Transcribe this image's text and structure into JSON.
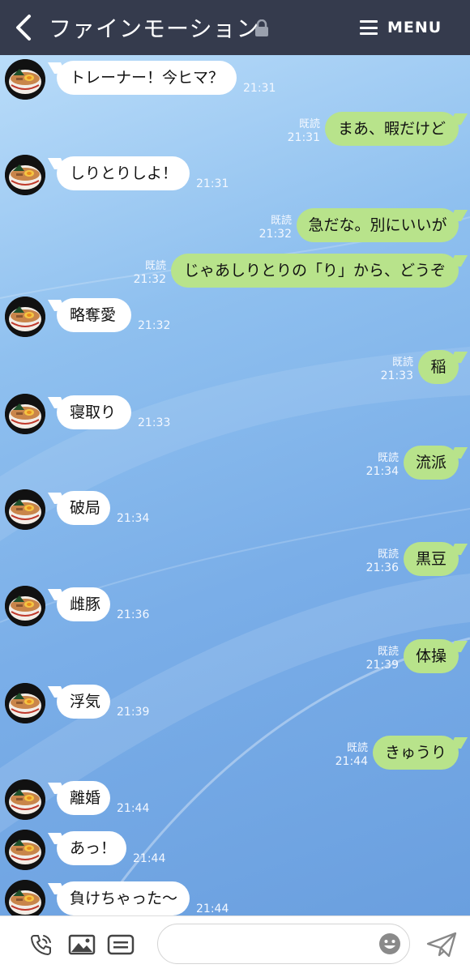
{
  "header": {
    "title": "ファインモーション",
    "menu_label": "MENU"
  },
  "messages": [
    {
      "side": "in",
      "text": "トレーナー！今ヒマ？",
      "time": "21:31"
    },
    {
      "side": "out",
      "text": "まあ、暇だけど",
      "read": "既読",
      "time": "21:31"
    },
    {
      "side": "in",
      "text": "しりとりしよ！",
      "time": "21:31"
    },
    {
      "side": "out",
      "text": "急だな。別にいいが",
      "read": "既読",
      "time": "21:32"
    },
    {
      "side": "out",
      "text": "じゃあしりとりの「り」から、どうぞ",
      "read": "既読",
      "time": "21:32"
    },
    {
      "side": "in",
      "text": "略奪愛",
      "time": "21:32"
    },
    {
      "side": "out",
      "text": "稲",
      "read": "既読",
      "time": "21:33"
    },
    {
      "side": "in",
      "text": "寝取り",
      "time": "21:33"
    },
    {
      "side": "out",
      "text": "流派",
      "read": "既読",
      "time": "21:34"
    },
    {
      "side": "in",
      "text": "破局",
      "time": "21:34"
    },
    {
      "side": "out",
      "text": "黒豆",
      "read": "既読",
      "time": "21:36"
    },
    {
      "side": "in",
      "text": "雌豚",
      "time": "21:36"
    },
    {
      "side": "out",
      "text": "体操",
      "read": "既読",
      "time": "21:39"
    },
    {
      "side": "in",
      "text": "浮気",
      "time": "21:39"
    },
    {
      "side": "out",
      "text": "きゅうり",
      "read": "既読",
      "time": "21:44"
    },
    {
      "side": "in",
      "text": "離婚",
      "time": "21:44"
    },
    {
      "side": "in",
      "text": "あっ！",
      "time": "21:44"
    },
    {
      "side": "in",
      "text": "負けちゃった〜",
      "time": "21:44"
    }
  ],
  "input": {
    "placeholder": "",
    "value": ""
  },
  "icons": {
    "back": "chevron-left-icon",
    "lock": "lock-icon",
    "menu": "hamburger-menu-icon",
    "call": "phone-call-icon",
    "image": "image-icon",
    "keyboard": "keyboard-icon",
    "emoji": "smiley-icon",
    "send": "send-icon"
  },
  "colors": {
    "header_bg": "#353b4d",
    "out_bubble": "#b8e38b",
    "in_bubble": "#ffffff",
    "chat_bg": "#8fc0ef"
  }
}
